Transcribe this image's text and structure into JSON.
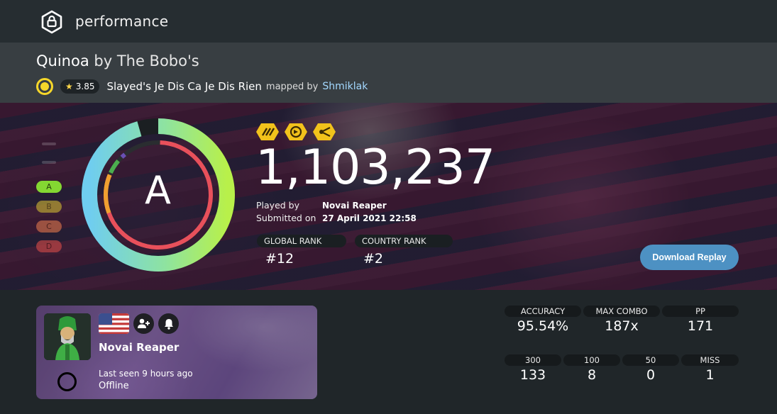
{
  "header": {
    "title": "performance",
    "logo_icon": "osu-lock-icon"
  },
  "beatmap": {
    "title": "Quinoa",
    "by_artist": "by The Bobo's",
    "star_rating": "3.85",
    "difficulty_name": "Slayed's Je Dis Ca Je Dis Rien",
    "mapped_by_label": "mapped by",
    "mapper": "Shmiklak",
    "difficulty_color": "#f6d72a"
  },
  "score": {
    "grade": "A",
    "total": "1,103,237",
    "mods": [
      "mod-hidden-icon",
      "mod-doubletime-icon",
      "mod-flashlight-icon"
    ],
    "played_by_label": "Played by",
    "played_by": "Novai Reaper",
    "submitted_label": "Submitted on",
    "submitted_on": "27 April 2021 22:58",
    "global_rank_label": "GLOBAL RANK",
    "global_rank": "#12",
    "country_rank_label": "COUNTRY RANK",
    "country_rank": "#2",
    "download_label": "Download Replay",
    "accuracy_fraction": 0.9554
  },
  "grades": [
    "A",
    "B",
    "C",
    "D"
  ],
  "user": {
    "name": "Novai Reaper",
    "country_flag": "us-flag",
    "last_seen": "Last seen 9 hours ago",
    "status": "Offline"
  },
  "stats": {
    "accuracy_label": "ACCURACY",
    "accuracy": "95.54%",
    "max_combo_label": "MAX COMBO",
    "max_combo": "187x",
    "pp_label": "PP",
    "pp": "171",
    "count_300_label": "300",
    "count_300": "133",
    "count_100_label": "100",
    "count_100": "8",
    "count_50_label": "50",
    "count_50": "0",
    "miss_label": "MISS",
    "miss": "1"
  },
  "colors": {
    "accent_blue": "#4d91c3",
    "mod_yellow": "#f2c21b",
    "grade_a": "#84d732"
  }
}
